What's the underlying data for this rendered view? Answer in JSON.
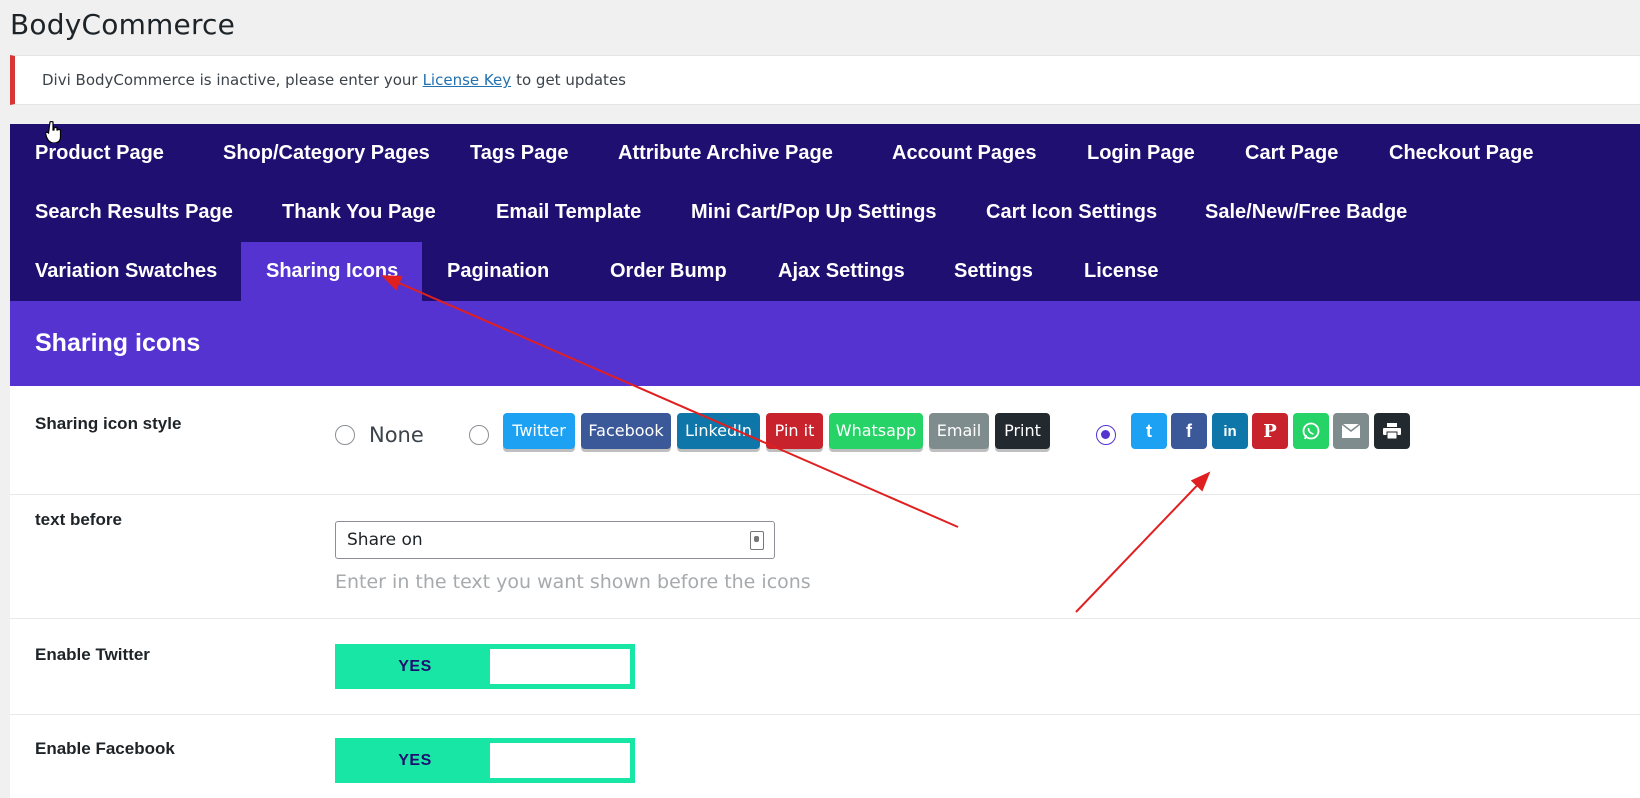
{
  "page_title": "BodyCommerce",
  "notice": {
    "text_before": "Divi BodyCommerce is inactive, please enter your",
    "link": "License Key",
    "text_after": "to get updates"
  },
  "tabs": [
    "Product Page",
    "Shop/Category Pages",
    "Tags Page",
    "Attribute Archive Page",
    "Account Pages",
    "Login Page",
    "Cart Page",
    "Checkout Page",
    "Search Results Page",
    "Thank You Page",
    "Email Template",
    "Mini Cart/Pop Up Settings",
    "Cart Icon Settings",
    "Sale/New/Free Badge",
    "Variation Swatches",
    "Sharing Icons",
    "Pagination",
    "Order Bump",
    "Ajax Settings",
    "Settings",
    "License"
  ],
  "active_tab": "Sharing Icons",
  "section_title": "Sharing icons",
  "style_row": {
    "label": "Sharing icon style",
    "none_label": "None",
    "text_buttons": [
      {
        "label": "Twitter",
        "color": "#1da1f2"
      },
      {
        "label": "Facebook",
        "color": "#3b5998"
      },
      {
        "label": "LinkedIn",
        "color": "#0e76a8"
      },
      {
        "label": "Pin it",
        "color": "#c8232c"
      },
      {
        "label": "Whatsapp",
        "color": "#25d366"
      },
      {
        "label": "Email",
        "color": "#7f8c8d"
      },
      {
        "label": "Print",
        "color": "#222a2f"
      }
    ],
    "icon_buttons": [
      {
        "icon": "tumblr-icon",
        "glyph": "t",
        "color": "#1da1f2"
      },
      {
        "icon": "facebook-icon",
        "glyph": "f",
        "color": "#3b5998"
      },
      {
        "icon": "linkedin-icon",
        "glyph": "in",
        "color": "#0e76a8"
      },
      {
        "icon": "pinterest-icon",
        "glyph": "P",
        "color": "#c8232c"
      },
      {
        "icon": "whatsapp-icon",
        "glyph": "",
        "color": "#25d366"
      },
      {
        "icon": "email-icon",
        "glyph": "",
        "color": "#7f8c8d"
      },
      {
        "icon": "print-icon",
        "glyph": "",
        "color": "#222a2f"
      }
    ],
    "selected": "icons"
  },
  "text_before_row": {
    "label": "text before",
    "value": "Share on",
    "help": "Enter in the text you want shown before the icons"
  },
  "twitter_row": {
    "label": "Enable Twitter",
    "toggle": "YES"
  },
  "facebook_row": {
    "label": "Enable Facebook",
    "toggle": "YES"
  }
}
